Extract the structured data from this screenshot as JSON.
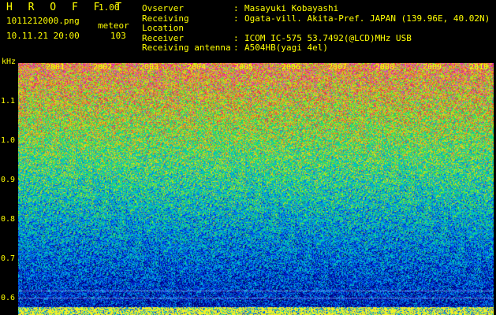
{
  "header": {
    "brand": "H R O F F T",
    "version": "1.00",
    "file": "1011212000.png",
    "mode": "meteor",
    "datetime": "10.11.21 20:00",
    "count": "103"
  },
  "info": [
    {
      "label": "Ovserver",
      "value": "Masayuki Kobayashi"
    },
    {
      "label": "Receiving Location",
      "value": "Ogata-vill. Akita-Pref. JAPAN (139.96E, 40.02N)"
    },
    {
      "label": "Receiver",
      "value": "ICOM IC-575 53.7492(@LCD)MHz USB"
    },
    {
      "label": "Receiving antenna",
      "value": "A504HB(yagi 4el)"
    }
  ],
  "axis": {
    "unit": "kHz",
    "y_ticks": [
      "1.1",
      "1.0",
      "0.9",
      "0.8",
      "0.7",
      "0.6"
    ],
    "x_ticks": [
      "2001",
      "2002",
      "2003",
      "2004",
      "2005",
      "2006",
      "2007",
      "2008",
      "2009",
      "2010"
    ]
  },
  "colors": {
    "label": "#ffff00",
    "background": "#000000"
  }
}
